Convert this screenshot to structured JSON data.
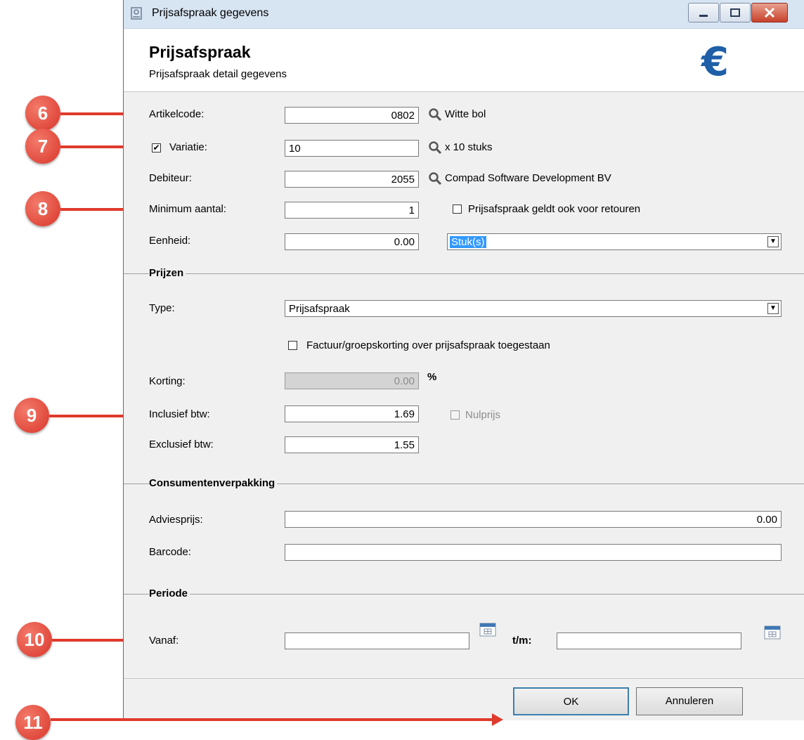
{
  "window": {
    "title": "Prijsafspraak gegevens"
  },
  "header": {
    "title": "Prijsafspraak",
    "subtitle": "Prijsafspraak detail gegevens",
    "logo_glyph": "€"
  },
  "form": {
    "artikelcode": {
      "label": "Artikelcode:",
      "value": "0802",
      "lookup_text": "Witte bol"
    },
    "variatie": {
      "label": "Variatie:",
      "checked": true,
      "value": "10",
      "lookup_text": "x 10 stuks"
    },
    "debiteur": {
      "label": "Debiteur:",
      "value": "2055",
      "lookup_text": "Compad Software Development BV"
    },
    "minimum_aantal": {
      "label": "Minimum aantal:",
      "value": "1"
    },
    "retouren": {
      "label": "Prijsafspraak geldt ook voor retouren",
      "checked": false
    },
    "eenheid": {
      "label": "Eenheid:",
      "value": "0.00",
      "unit_selected": "Stuk(s)"
    }
  },
  "prijzen": {
    "section_title": "Prijzen",
    "type": {
      "label": "Type:",
      "selected": "Prijsafspraak"
    },
    "factuurkorting": {
      "label": "Factuur/groepskorting over prijsafspraak toegestaan",
      "checked": false
    },
    "korting": {
      "label": "Korting:",
      "value": "0.00",
      "unit": "%"
    },
    "inclusief": {
      "label": "Inclusief btw:",
      "value": "1.69"
    },
    "nulprijs": {
      "label": "Nulprijs",
      "checked": false
    },
    "exclusief": {
      "label": "Exclusief btw:",
      "value": "1.55"
    }
  },
  "consumentenverpakking": {
    "section_title": "Consumentenverpakking",
    "adviesprijs": {
      "label": "Adviesprijs:",
      "value": "0.00"
    },
    "barcode": {
      "label": "Barcode:",
      "value": ""
    }
  },
  "periode": {
    "section_title": "Periode",
    "vanaf": {
      "label": "Vanaf:",
      "value": ""
    },
    "tm": {
      "label": "t/m:",
      "value": ""
    }
  },
  "buttons": {
    "ok": "OK",
    "cancel": "Annuleren"
  },
  "callouts": [
    "6",
    "7",
    "8",
    "9",
    "10",
    "11"
  ],
  "colors": {
    "callout": "#e03a2c",
    "accent": "#1f5fa8",
    "selection": "#3399ff"
  },
  "icons": {
    "lookup": "magnifier-icon",
    "calendar": "calendar-icon"
  }
}
